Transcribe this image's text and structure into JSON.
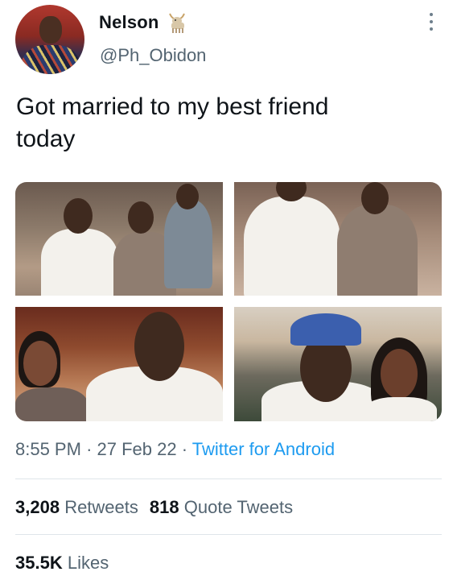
{
  "author": {
    "name": "Nelson",
    "handle": "@Ph_Obidon",
    "badge_icon": "goat-emoji-icon"
  },
  "tweet": {
    "text_line1": "Got married to my best friend",
    "text_line2": "today",
    "photo_count": 4
  },
  "meta": {
    "time": "8:55 PM",
    "separator": "·",
    "date": "27 Feb 22",
    "source": "Twitter for Android"
  },
  "stats": {
    "retweets_count": "3,208",
    "retweets_label": "Retweets",
    "quote_count": "818",
    "quote_label": "Quote Tweets",
    "likes_count": "35.5K",
    "likes_label": "Likes"
  },
  "colors": {
    "text": "#0f1419",
    "secondary": "#536471",
    "link": "#1d9bf0",
    "divider": "#dfe5ea"
  }
}
